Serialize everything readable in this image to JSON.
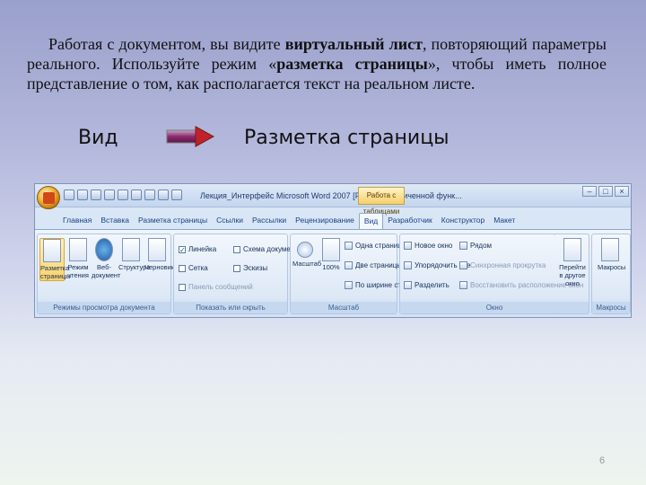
{
  "slide": {
    "paragraph": {
      "p1": "Работая с документом, вы видите ",
      "b1": "виртуальный лист",
      "p2": ", повторяющий параметры реального. Используйте режим «",
      "b2": "разметка страницы",
      "p3": "», чтобы иметь полное представление о том, как располагается текст на реальном листе."
    },
    "menu_label": "Вид",
    "target_label": "Разметка страницы",
    "page_number": "6"
  },
  "window": {
    "title": "Лекция_Интерфейс Microsoft Word 2007 [Режим ограниченной функ...",
    "context_tab": "Работа с таблицами"
  },
  "tabs": [
    {
      "label": "Главная"
    },
    {
      "label": "Вставка"
    },
    {
      "label": "Разметка страницы"
    },
    {
      "label": "Ссылки"
    },
    {
      "label": "Рассылки"
    },
    {
      "label": "Рецензирование"
    },
    {
      "label": "Вид"
    },
    {
      "label": "Разработчик"
    },
    {
      "label": "Конструктор"
    },
    {
      "label": "Макет"
    }
  ],
  "groups": {
    "views": {
      "name": "Режимы просмотра документа",
      "buttons": [
        {
          "label": "Разметка страницы"
        },
        {
          "label": "Режим чтения"
        },
        {
          "label": "Веб-документ"
        },
        {
          "label": "Структура"
        },
        {
          "label": "Черновик"
        }
      ]
    },
    "show_hide": {
      "name": "Показать или скрыть",
      "items": [
        {
          "label": "Линейка",
          "checked": "✓"
        },
        {
          "label": "Сетка",
          "checked": ""
        },
        {
          "label": "Панель сообщений",
          "checked": ""
        },
        {
          "label": "Схема документа",
          "checked": ""
        },
        {
          "label": "Эскизы",
          "checked": ""
        }
      ]
    },
    "zoom": {
      "name": "Масштаб",
      "zoom_label": "Масштаб",
      "percent_label": "100%",
      "items": [
        {
          "label": "Одна страница"
        },
        {
          "label": "Две страницы"
        },
        {
          "label": "По ширине страницы"
        }
      ]
    },
    "window": {
      "name": "Окно",
      "items": [
        {
          "label": "Новое окно"
        },
        {
          "label": "Упорядочить все"
        },
        {
          "label": "Разделить"
        },
        {
          "label": "Рядом"
        },
        {
          "label": "Синхронная прокрутка"
        },
        {
          "label": "Восстановить расположение окон"
        }
      ],
      "switch_label": "Перейти в другое окно"
    },
    "macros": {
      "name": "Макросы",
      "button_label": "Макросы"
    }
  }
}
